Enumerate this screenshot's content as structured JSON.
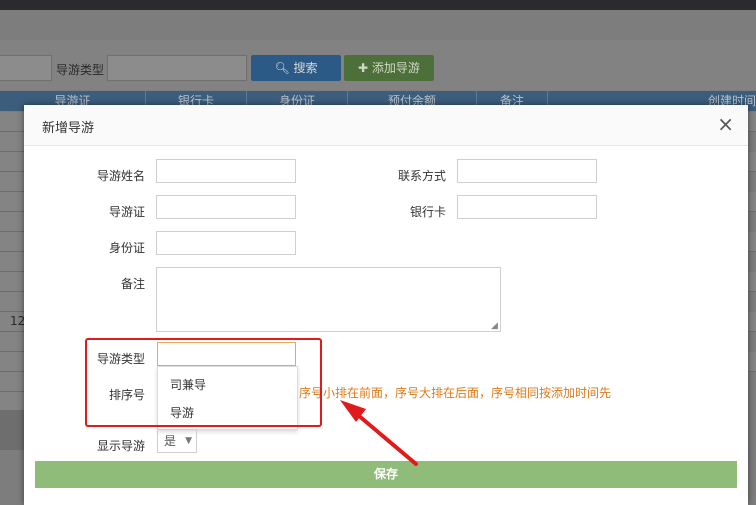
{
  "background": {
    "filter_label": "导游类型",
    "search_button": "搜索",
    "add_button": "添加导游",
    "columns": [
      "导游证",
      "银行卡",
      "身份证",
      "预付余额",
      "备注",
      "创建时间"
    ],
    "row_fragment": "12"
  },
  "modal": {
    "title": "新增导游",
    "close": "×",
    "fields": {
      "name_label": "导游姓名",
      "contact_label": "联系方式",
      "guide_cert_label": "导游证",
      "bank_card_label": "银行卡",
      "id_card_label": "身份证",
      "remark_label": "备注",
      "type_label": "导游类型",
      "sort_label": "排序号",
      "show_label": "显示导游"
    },
    "type_options": [
      "司兼导",
      "导游"
    ],
    "sort_hint": "序号小排在前面，序号大排在后面，序号相同按添加时间先",
    "show_value": "是",
    "save_button": "保存"
  },
  "colors": {
    "annotation_red": "#e11b1b",
    "save_green": "#8fbc79",
    "hint_orange": "#e07a1a"
  }
}
